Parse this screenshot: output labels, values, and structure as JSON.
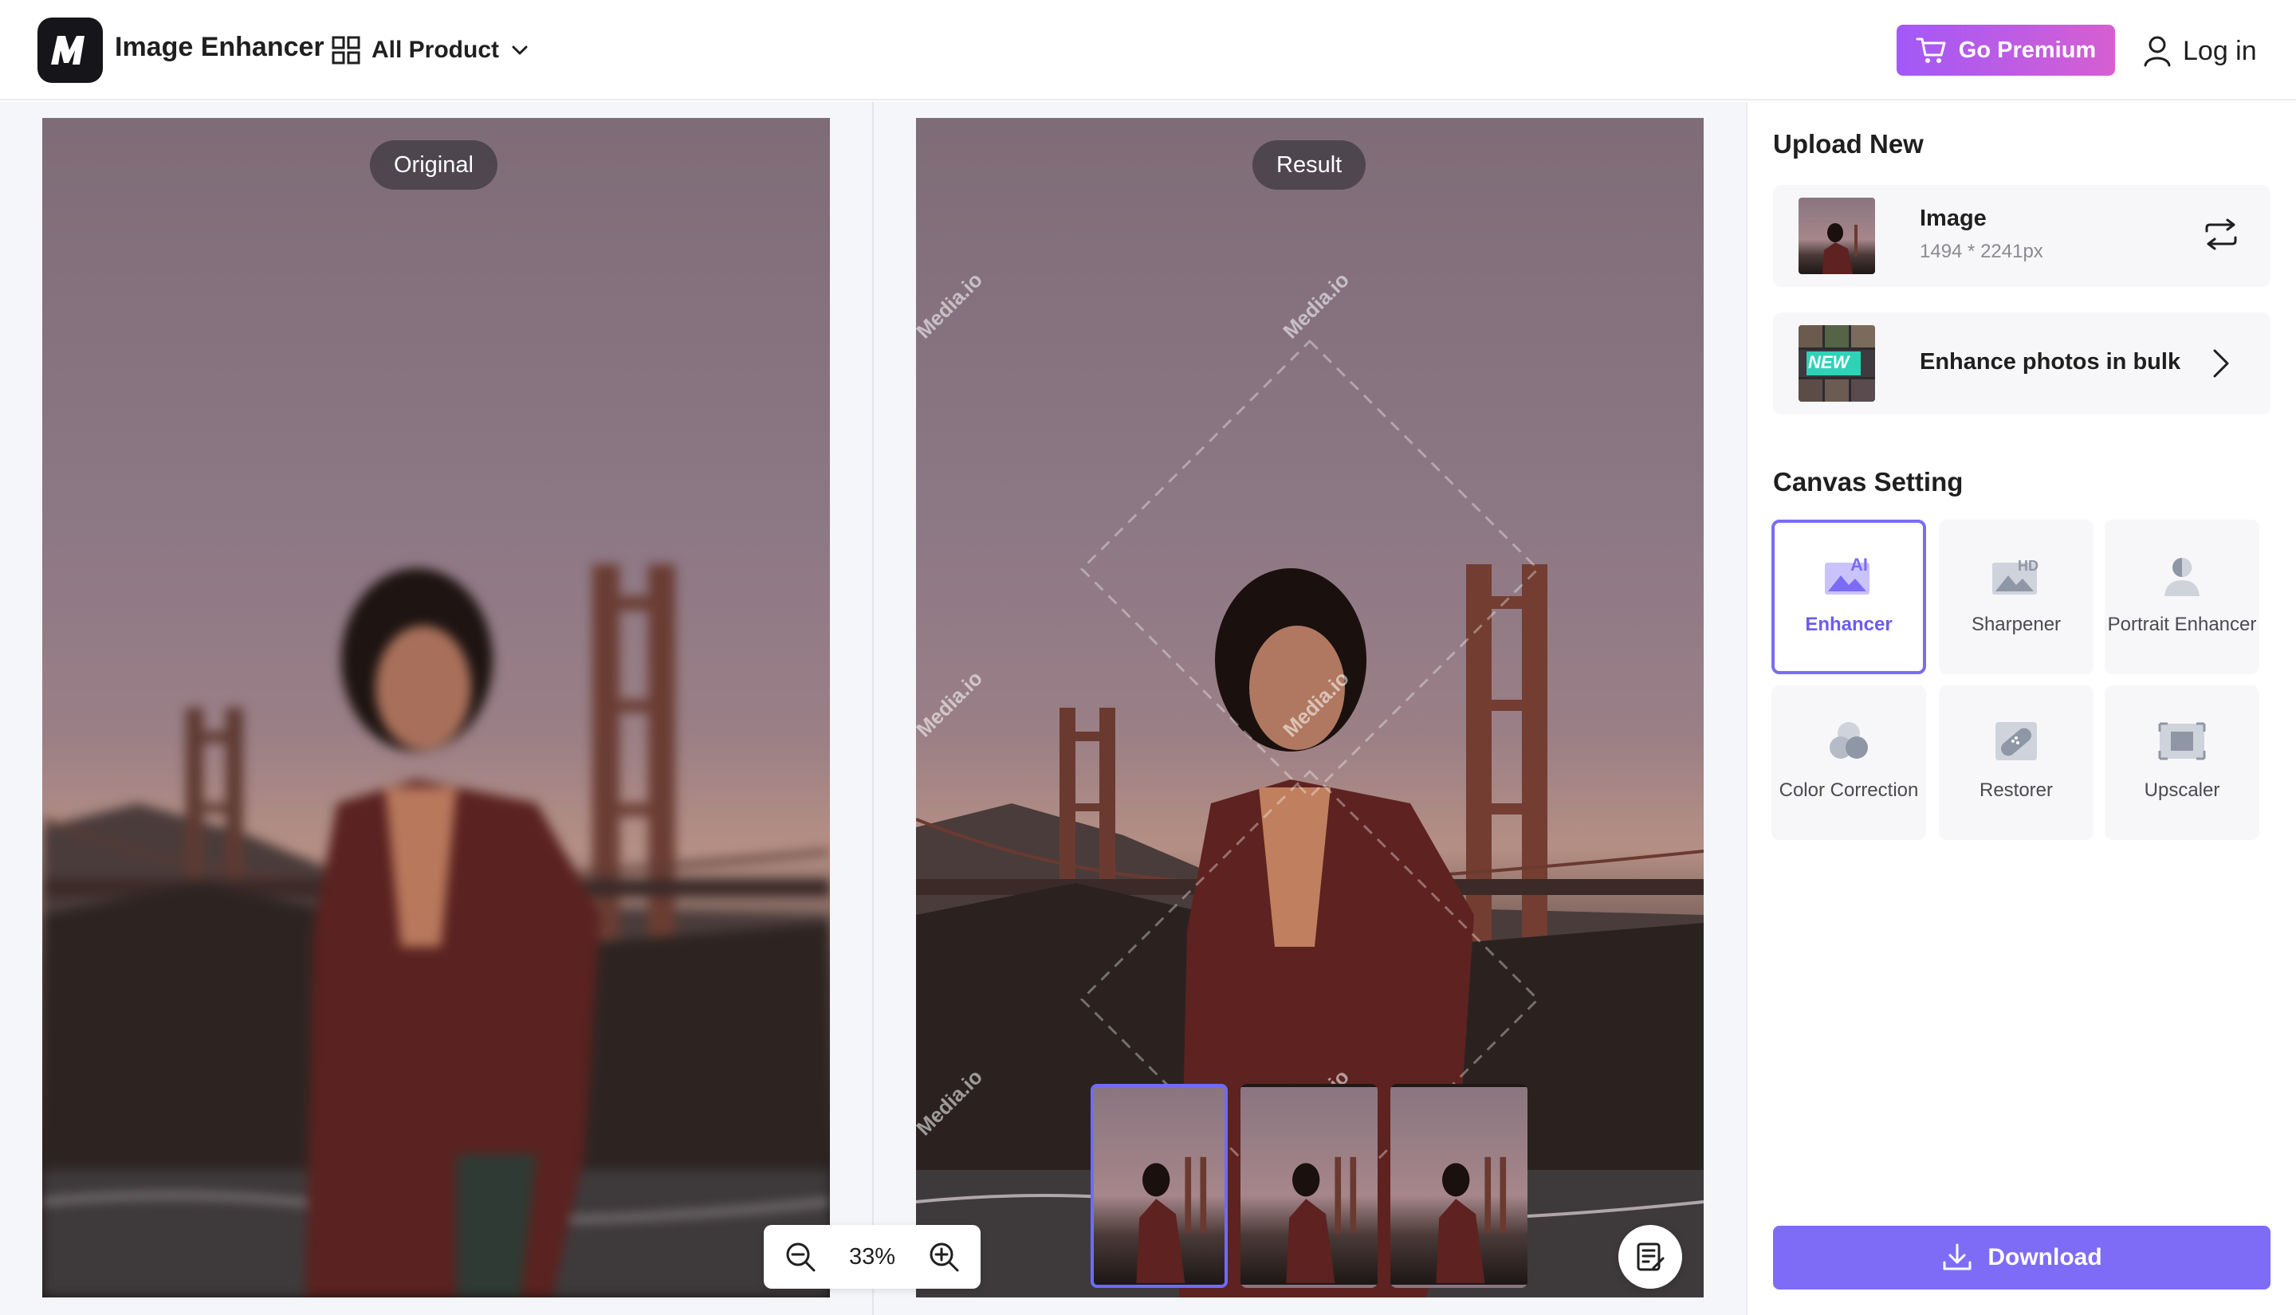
{
  "header": {
    "app_title": "Image Enhancer",
    "all_product_label": "All Product",
    "premium_label": "Go Premium",
    "login_label": "Log in"
  },
  "compare": {
    "original_label": "Original",
    "result_label": "Result",
    "zoom_value": "33%",
    "watermark_text": "Media.io"
  },
  "panel": {
    "upload_title": "Upload New",
    "image_card": {
      "title": "Image",
      "dimensions": "1494 * 2241px"
    },
    "bulk_card": {
      "badge": "NEW",
      "title": "Enhance photos in bulk"
    },
    "canvas_title": "Canvas Setting",
    "tools": [
      {
        "label": "Enhancer",
        "icon": "ai-image-icon",
        "active": true
      },
      {
        "label": "Sharpener",
        "icon": "hd-image-icon",
        "active": false
      },
      {
        "label": "Portrait Enhancer",
        "icon": "portrait-icon",
        "active": false
      },
      {
        "label": "Color Correction",
        "icon": "color-circles-icon",
        "active": false
      },
      {
        "label": "Restorer",
        "icon": "bandage-icon",
        "active": false
      },
      {
        "label": "Upscaler",
        "icon": "upscale-frame-icon",
        "active": false
      }
    ],
    "download_label": "Download"
  },
  "colors": {
    "accent": "#7e6cf7",
    "premium_gradient_start": "#a259f7",
    "premium_gradient_end": "#d65fd1",
    "active_border": "#7b6cf6"
  }
}
